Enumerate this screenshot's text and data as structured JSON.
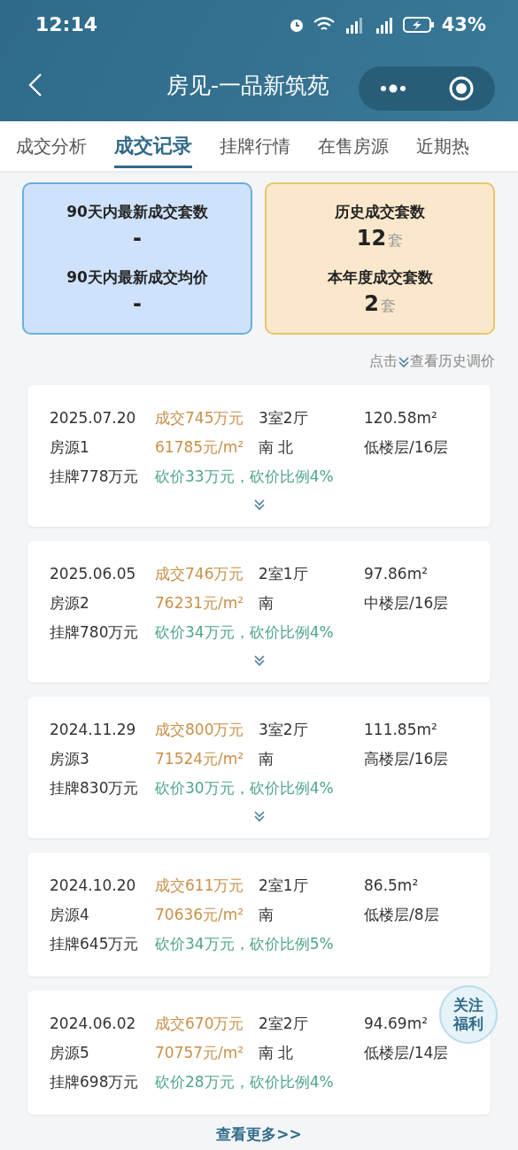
{
  "status_bar": {
    "time": "12:14",
    "battery": "43%"
  },
  "header": {
    "title": "房见-一品新筑苑"
  },
  "tabs": [
    {
      "label": "成交分析",
      "selected": false
    },
    {
      "label": "成交记录",
      "selected": true
    },
    {
      "label": "挂牌行情",
      "selected": false
    },
    {
      "label": "在售房源",
      "selected": false
    },
    {
      "label": "近期热",
      "selected": false
    }
  ],
  "stats": [
    {
      "kind": "blue",
      "items": [
        {
          "label": "90天内最新成交套数",
          "value": "-"
        },
        {
          "label": "90天内最新成交均价",
          "value": "-"
        }
      ]
    },
    {
      "kind": "orange",
      "items": [
        {
          "label": "历史成交套数",
          "value": "12",
          "unit": "套"
        },
        {
          "label": "本年度成交套数",
          "value": "2",
          "unit": "套"
        }
      ]
    }
  ],
  "history_hint": {
    "before": "点击",
    "after": "查看历史调价"
  },
  "records": [
    {
      "date": "2025.07.20",
      "deal": "成交745万元",
      "layout": "3室2厅",
      "area": "120.58m²",
      "source": "房源1",
      "unit_price": "61785元/m²",
      "orientation": "南 北",
      "floor": "低楼层/16层",
      "listing": "挂牌778万元",
      "discount": "砍价33万元，砍价比例4%",
      "expandable": true
    },
    {
      "date": "2025.06.05",
      "deal": "成交746万元",
      "layout": "2室1厅",
      "area": "97.86m²",
      "source": "房源2",
      "unit_price": "76231元/m²",
      "orientation": "南",
      "floor": "中楼层/16层",
      "listing": "挂牌780万元",
      "discount": "砍价34万元，砍价比例4%",
      "expandable": true
    },
    {
      "date": "2024.11.29",
      "deal": "成交800万元",
      "layout": "3室2厅",
      "area": "111.85m²",
      "source": "房源3",
      "unit_price": "71524元/m²",
      "orientation": "南",
      "floor": "高楼层/16层",
      "listing": "挂牌830万元",
      "discount": "砍价30万元，砍价比例4%",
      "expandable": true
    },
    {
      "date": "2024.10.20",
      "deal": "成交611万元",
      "layout": "2室1厅",
      "area": "86.5m²",
      "source": "房源4",
      "unit_price": "70636元/m²",
      "orientation": "南",
      "floor": "低楼层/8层",
      "listing": "挂牌645万元",
      "discount": "砍价34万元，砍价比例5%",
      "expandable": false
    },
    {
      "date": "2024.06.02",
      "deal": "成交670万元",
      "layout": "2室2厅",
      "area": "94.69m²",
      "source": "房源5",
      "unit_price": "70757元/m²",
      "orientation": "南 北",
      "floor": "低楼层/14层",
      "listing": "挂牌698万元",
      "discount": "砍价28万元，砍价比例4%",
      "expandable": false
    }
  ],
  "follow_badge": {
    "line1": "关注",
    "line2": "福利"
  },
  "more_link": "查看更多>>"
}
